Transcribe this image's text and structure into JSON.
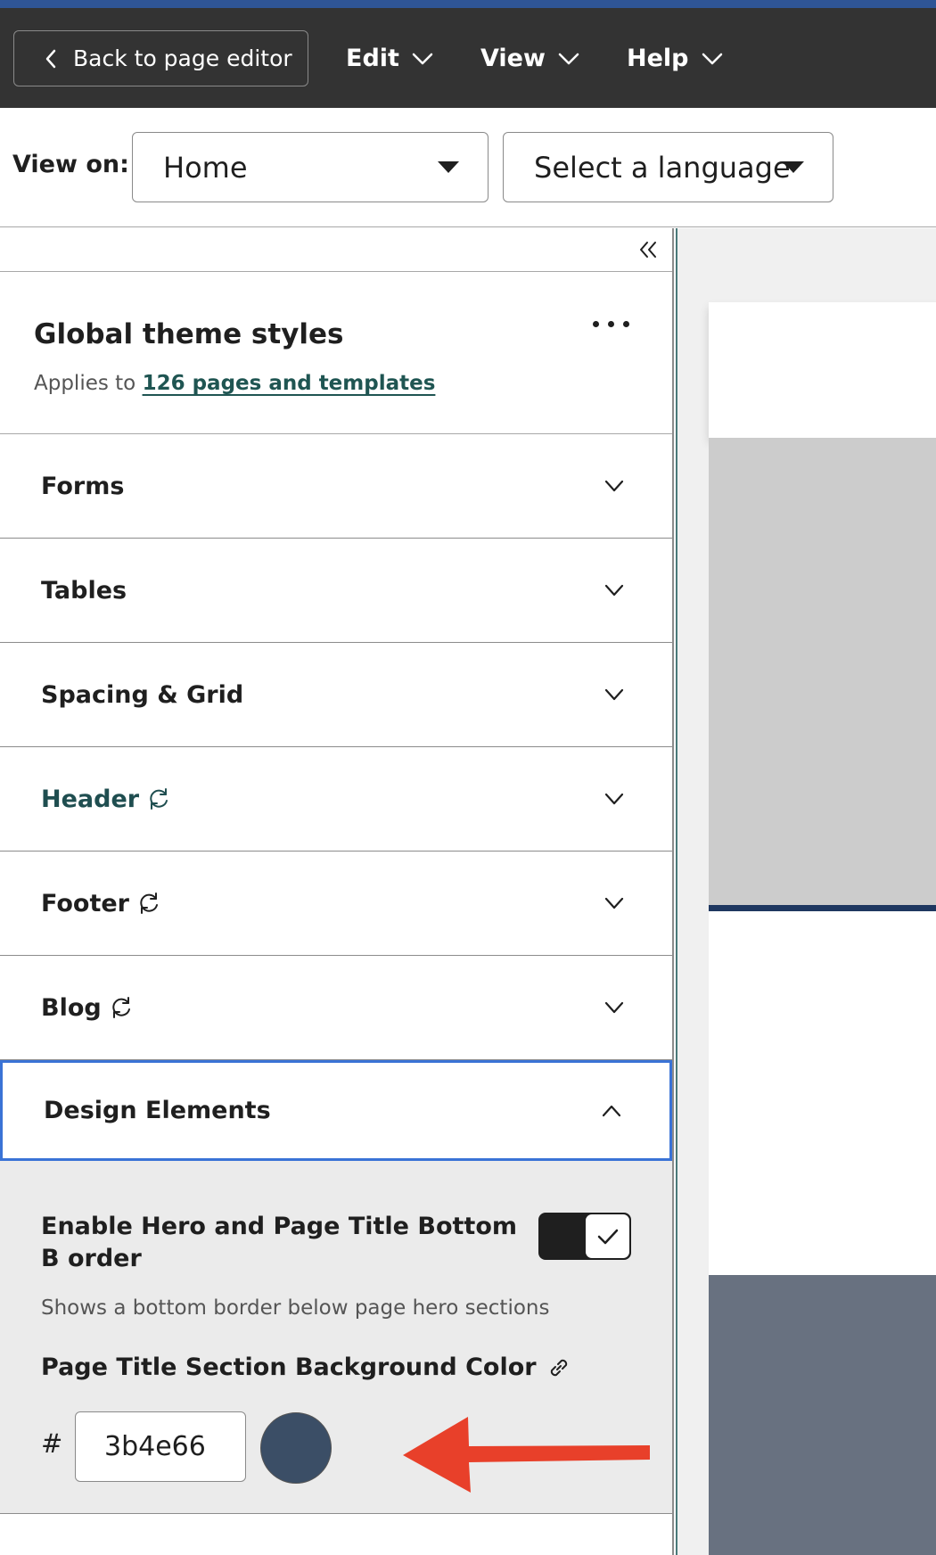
{
  "toolbar": {
    "back_label": "Back to page editor",
    "menus": [
      "Edit",
      "View",
      "Help"
    ]
  },
  "viewon": {
    "label": "View on:",
    "page_select": "Home",
    "language_select": "Select a language"
  },
  "theme": {
    "title": "Global theme styles",
    "applies_prefix": "Applies to",
    "applies_link": "126 pages and templates"
  },
  "sections": [
    {
      "label": "Forms"
    },
    {
      "label": "Tables"
    },
    {
      "label": "Spacing & Grid"
    },
    {
      "label": "Header"
    },
    {
      "label": "Footer"
    },
    {
      "label": "Blog"
    },
    {
      "label": "Design Elements"
    }
  ],
  "design": {
    "toggle_title": "Enable Hero and Page Title Bottom B order",
    "toggle_desc": "Shows a bottom border below page hero sections",
    "toggle_on": true,
    "color_label": "Page Title Section Background Color",
    "hash": "#",
    "hex_value": "3b4e66",
    "swatch_color": "#3b4e66"
  },
  "colors": {
    "accent": "#2f5596",
    "toolbar_bg": "#333333",
    "teal_text": "#1f4e50",
    "focus_border": "#3a73d6",
    "arrow": "#e8402a"
  }
}
